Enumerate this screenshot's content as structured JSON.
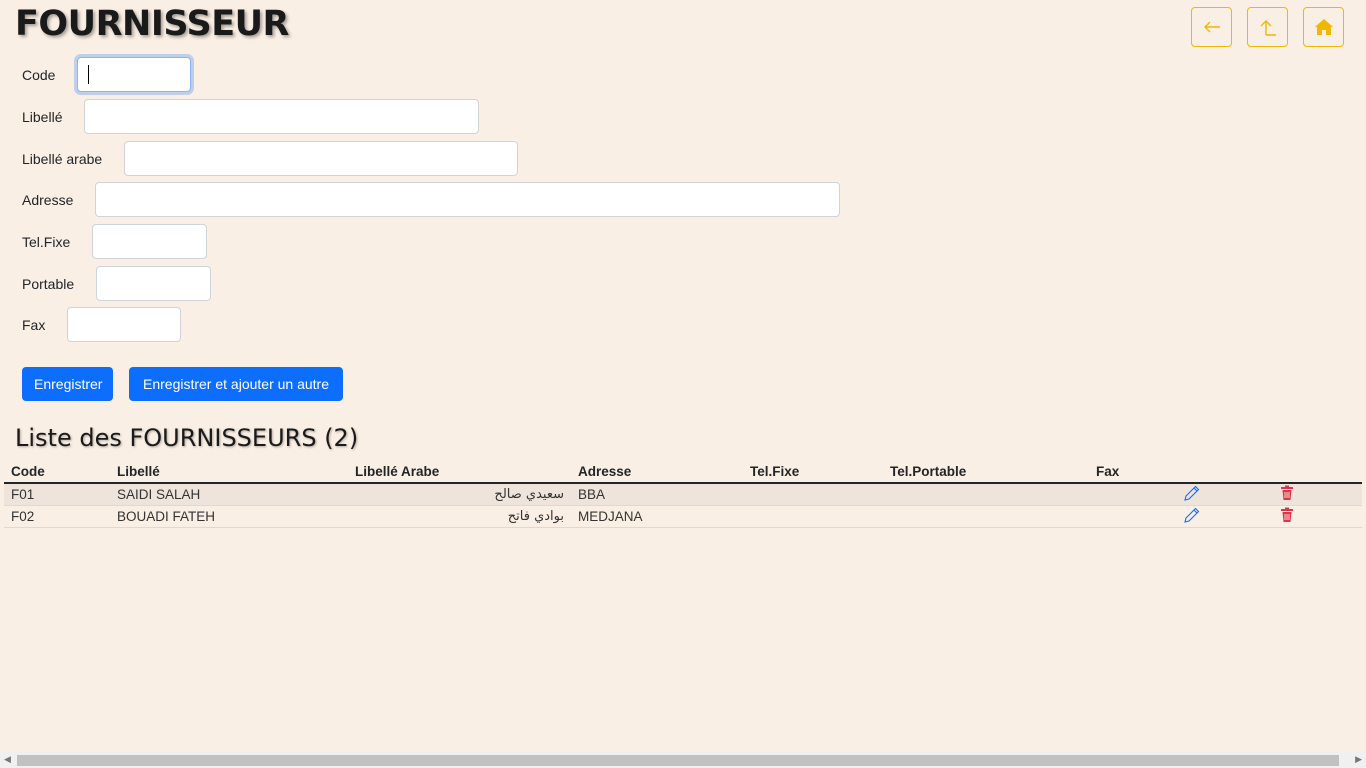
{
  "header": {
    "title": "FOURNISSEUR"
  },
  "nav": {
    "back_icon": "arrow-left-icon",
    "up_icon": "arrow-up-icon",
    "home_icon": "home-icon",
    "accent_color": "#f2b705"
  },
  "form": {
    "code_label": "Code",
    "code_value": "",
    "libelle_label": "Libellé",
    "libelle_value": "",
    "libelle_arabe_label": "Libellé arabe",
    "libelle_arabe_value": "",
    "adresse_label": "Adresse",
    "adresse_value": "",
    "tel_fixe_label": "Tel.Fixe",
    "tel_fixe_value": "",
    "portable_label": "Portable",
    "portable_value": "",
    "fax_label": "Fax",
    "fax_value": "",
    "save_label": "Enregistrer",
    "save_add_label": "Enregistrer et ajouter un autre",
    "primary_color": "#0d6efd"
  },
  "list": {
    "title": "Liste des FOURNISSEURS (2)",
    "columns": [
      "Code",
      "Libellé",
      "Libellé Arabe",
      "Adresse",
      "Tel.Fixe",
      "Tel.Portable",
      "Fax"
    ],
    "rows": [
      {
        "code": "F01",
        "libelle": "SAIDI SALAH",
        "libelle_arabe": "سعيدي صالح",
        "adresse": "BBA",
        "tel_fixe": "",
        "tel_portable": "",
        "fax": ""
      },
      {
        "code": "F02",
        "libelle": "BOUADI FATEH",
        "libelle_arabe": "بوادي فاتح",
        "adresse": "MEDJANA",
        "tel_fixe": "",
        "tel_portable": "",
        "fax": ""
      }
    ],
    "edit_icon": "pencil-icon",
    "delete_icon": "trash-icon",
    "edit_color": "#0d6efd",
    "delete_color": "#dc3545"
  }
}
